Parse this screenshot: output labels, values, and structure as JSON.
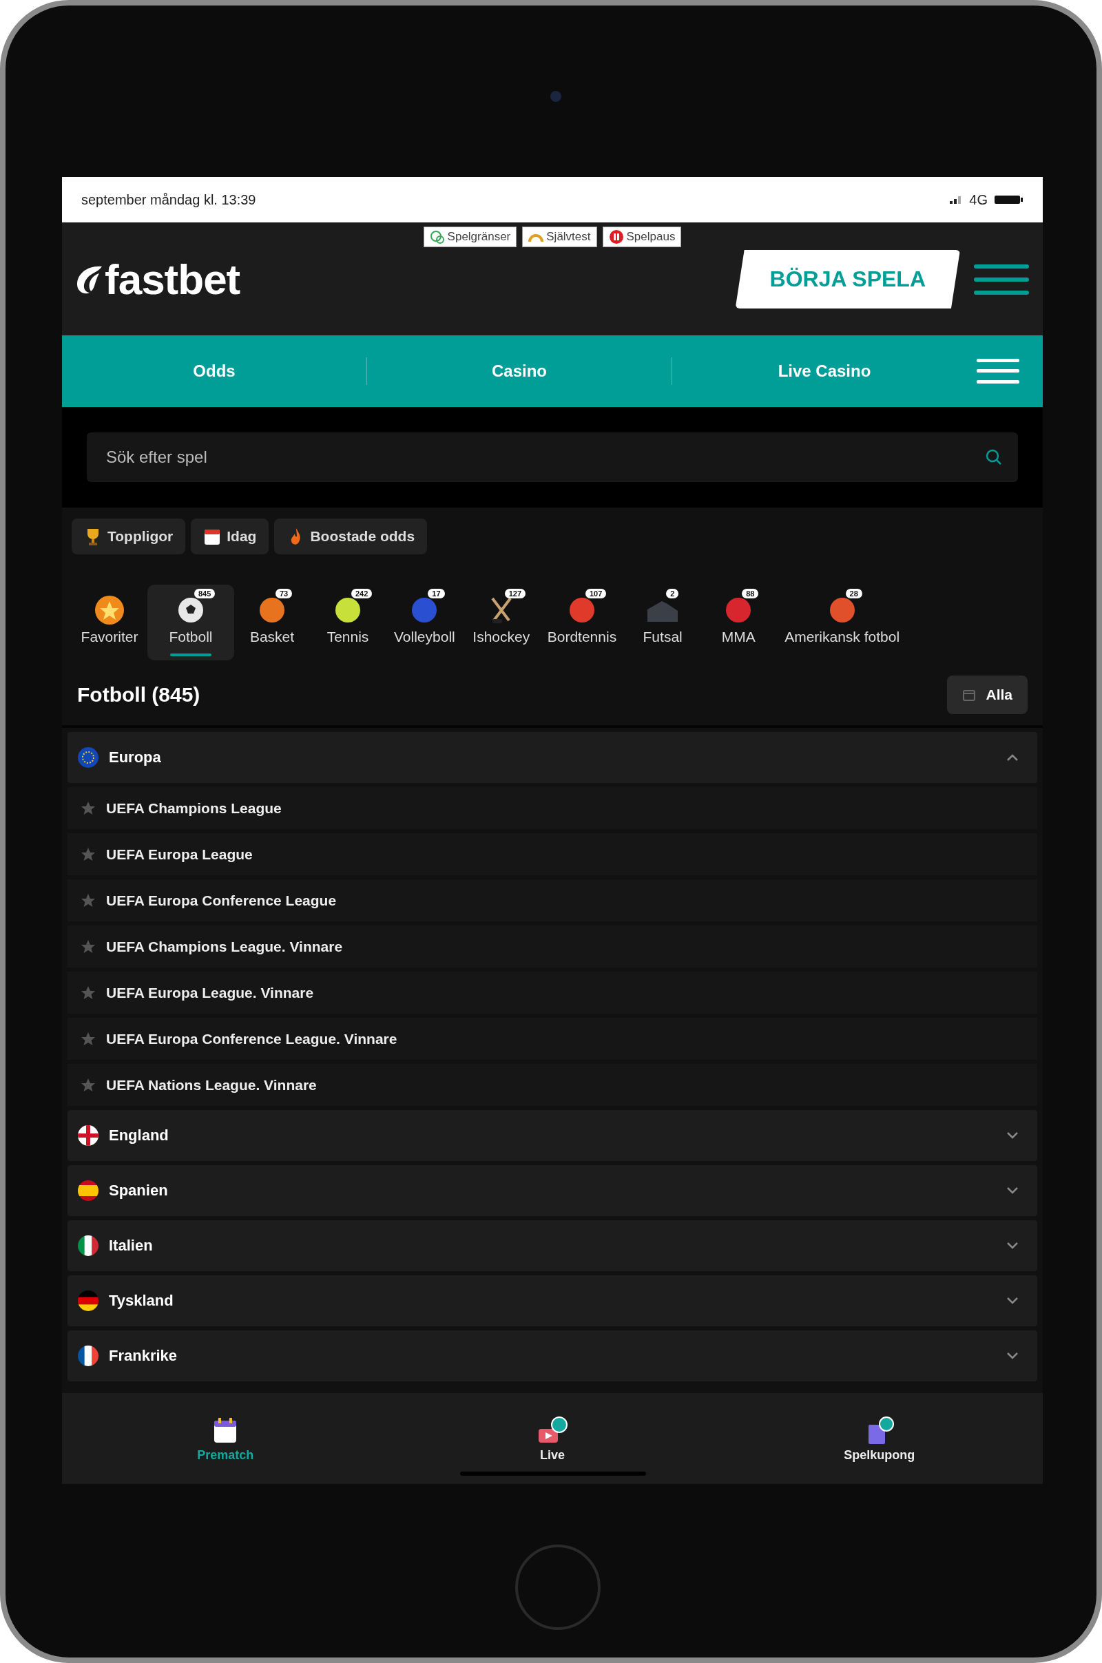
{
  "status_bar": {
    "date_time": "september måndag kl. 13:39",
    "network": "4G"
  },
  "responsible_links": [
    {
      "label": "Spelgränser",
      "kind": "limits"
    },
    {
      "label": "Självtest",
      "kind": "test"
    },
    {
      "label": "Spelpaus",
      "kind": "pause"
    }
  ],
  "header": {
    "logo": "fastbet",
    "cta": "BÖRJA SPELA"
  },
  "nav": {
    "tabs": [
      {
        "label": "Odds"
      },
      {
        "label": "Casino"
      },
      {
        "label": "Live Casino"
      }
    ]
  },
  "search": {
    "placeholder": "Sök efter spel"
  },
  "chips": [
    {
      "label": "Toppligor",
      "kind": "trophy"
    },
    {
      "label": "Idag",
      "kind": "calendar"
    },
    {
      "label": "Boostade odds",
      "kind": "boost"
    }
  ],
  "sports": [
    {
      "label": "Favoriter",
      "kind": "star",
      "selected": false
    },
    {
      "label": "Fotboll",
      "count": "845",
      "kind": "soccer",
      "selected": true
    },
    {
      "label": "Basket",
      "count": "73",
      "kind": "basket",
      "selected": false
    },
    {
      "label": "Tennis",
      "count": "242",
      "kind": "tennis",
      "selected": false
    },
    {
      "label": "Volleyboll",
      "count": "17",
      "kind": "volley",
      "selected": false
    },
    {
      "label": "Ishockey",
      "count": "127",
      "kind": "hockey",
      "selected": false
    },
    {
      "label": "Bordtennis",
      "count": "107",
      "kind": "pingpong",
      "selected": false
    },
    {
      "label": "Futsal",
      "count": "2",
      "kind": "futsal",
      "selected": false
    },
    {
      "label": "MMA",
      "count": "88",
      "kind": "mma",
      "selected": false
    },
    {
      "label": "Amerikansk fotbol",
      "count": "28",
      "kind": "american",
      "selected": false
    }
  ],
  "section": {
    "title": "Fotboll (845)",
    "filter": "Alla"
  },
  "regions": [
    {
      "name": "Europa",
      "kind": "eu",
      "expanded": true,
      "leagues": [
        "UEFA Champions League",
        "UEFA Europa League",
        "UEFA Europa Conference League",
        "UEFA Champions League. Vinnare",
        "UEFA Europa League. Vinnare",
        "UEFA Europa Conference League. Vinnare",
        "UEFA Nations League. Vinnare"
      ]
    },
    {
      "name": "England",
      "kind": "england",
      "expanded": false
    },
    {
      "name": "Spanien",
      "kind": "spain",
      "expanded": false
    },
    {
      "name": "Italien",
      "kind": "italy",
      "expanded": false
    },
    {
      "name": "Tyskland",
      "kind": "germany",
      "expanded": false
    },
    {
      "name": "Frankrike",
      "kind": "france",
      "expanded": false
    }
  ],
  "bottom_nav": [
    {
      "label": "Prematch",
      "kind": "calendar",
      "selected": true
    },
    {
      "label": "Live",
      "kind": "live",
      "selected": false
    },
    {
      "label": "Spelkupong",
      "kind": "coupon",
      "selected": false
    }
  ]
}
